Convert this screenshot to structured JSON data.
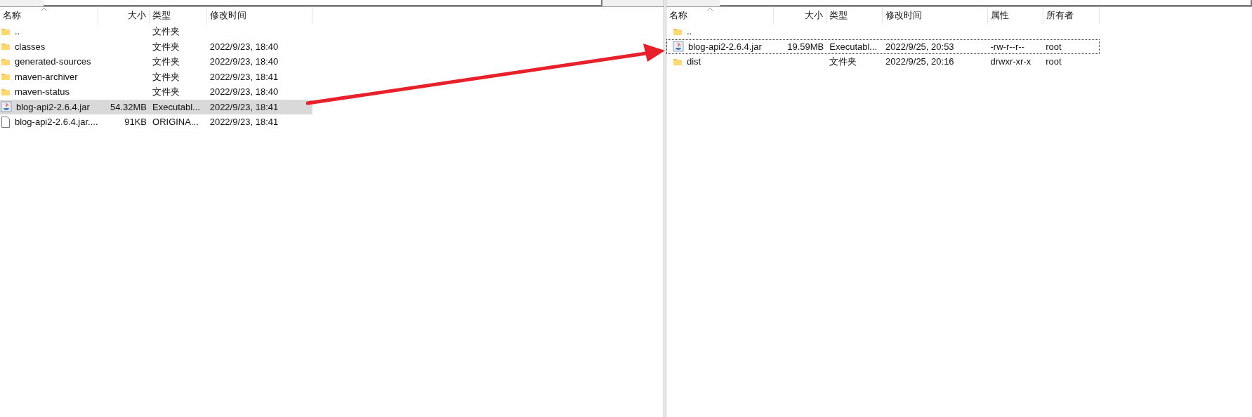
{
  "left_panel": {
    "columns": [
      "名称",
      "大小",
      "类型",
      "修改时间"
    ],
    "rows": [
      {
        "kind": "folder",
        "name": "..",
        "type": "文件夹",
        "selected": false
      },
      {
        "kind": "folder",
        "name": "classes",
        "type": "文件夹",
        "modified": "2022/9/23, 18:40",
        "selected": false
      },
      {
        "kind": "folder",
        "name": "generated-sources",
        "type": "文件夹",
        "modified": "2022/9/23, 18:40",
        "selected": false
      },
      {
        "kind": "folder",
        "name": "maven-archiver",
        "type": "文件夹",
        "modified": "2022/9/23, 18:41",
        "selected": false
      },
      {
        "kind": "folder",
        "name": "maven-status",
        "type": "文件夹",
        "modified": "2022/9/23, 18:40",
        "selected": false
      },
      {
        "kind": "jar",
        "name": "blog-api2-2.6.4.jar",
        "size": "54.32MB",
        "type": "Executabl...",
        "modified": "2022/9/23, 18:41",
        "selected": true
      },
      {
        "kind": "file",
        "name": "blog-api2-2.6.4.jar....",
        "size": "91KB",
        "type": "ORIGINA...",
        "modified": "2022/9/23, 18:41",
        "selected": false
      }
    ]
  },
  "right_panel": {
    "columns": [
      "名称",
      "大小",
      "类型",
      "修改时间",
      "属性",
      "所有者"
    ],
    "rows": [
      {
        "kind": "folder",
        "name": "..",
        "focused": false
      },
      {
        "kind": "jar",
        "name": "blog-api2-2.6.4.jar",
        "size": "19.59MB",
        "type": "Executabl...",
        "modified": "2022/9/25, 20:53",
        "rights": "-rw-r--r--",
        "owner": "root",
        "focused": true
      },
      {
        "kind": "folder",
        "name": "dist",
        "type": "文件夹",
        "modified": "2022/9/25, 20:16",
        "rights": "drwxr-xr-x",
        "owner": "root",
        "focused": false
      }
    ]
  }
}
